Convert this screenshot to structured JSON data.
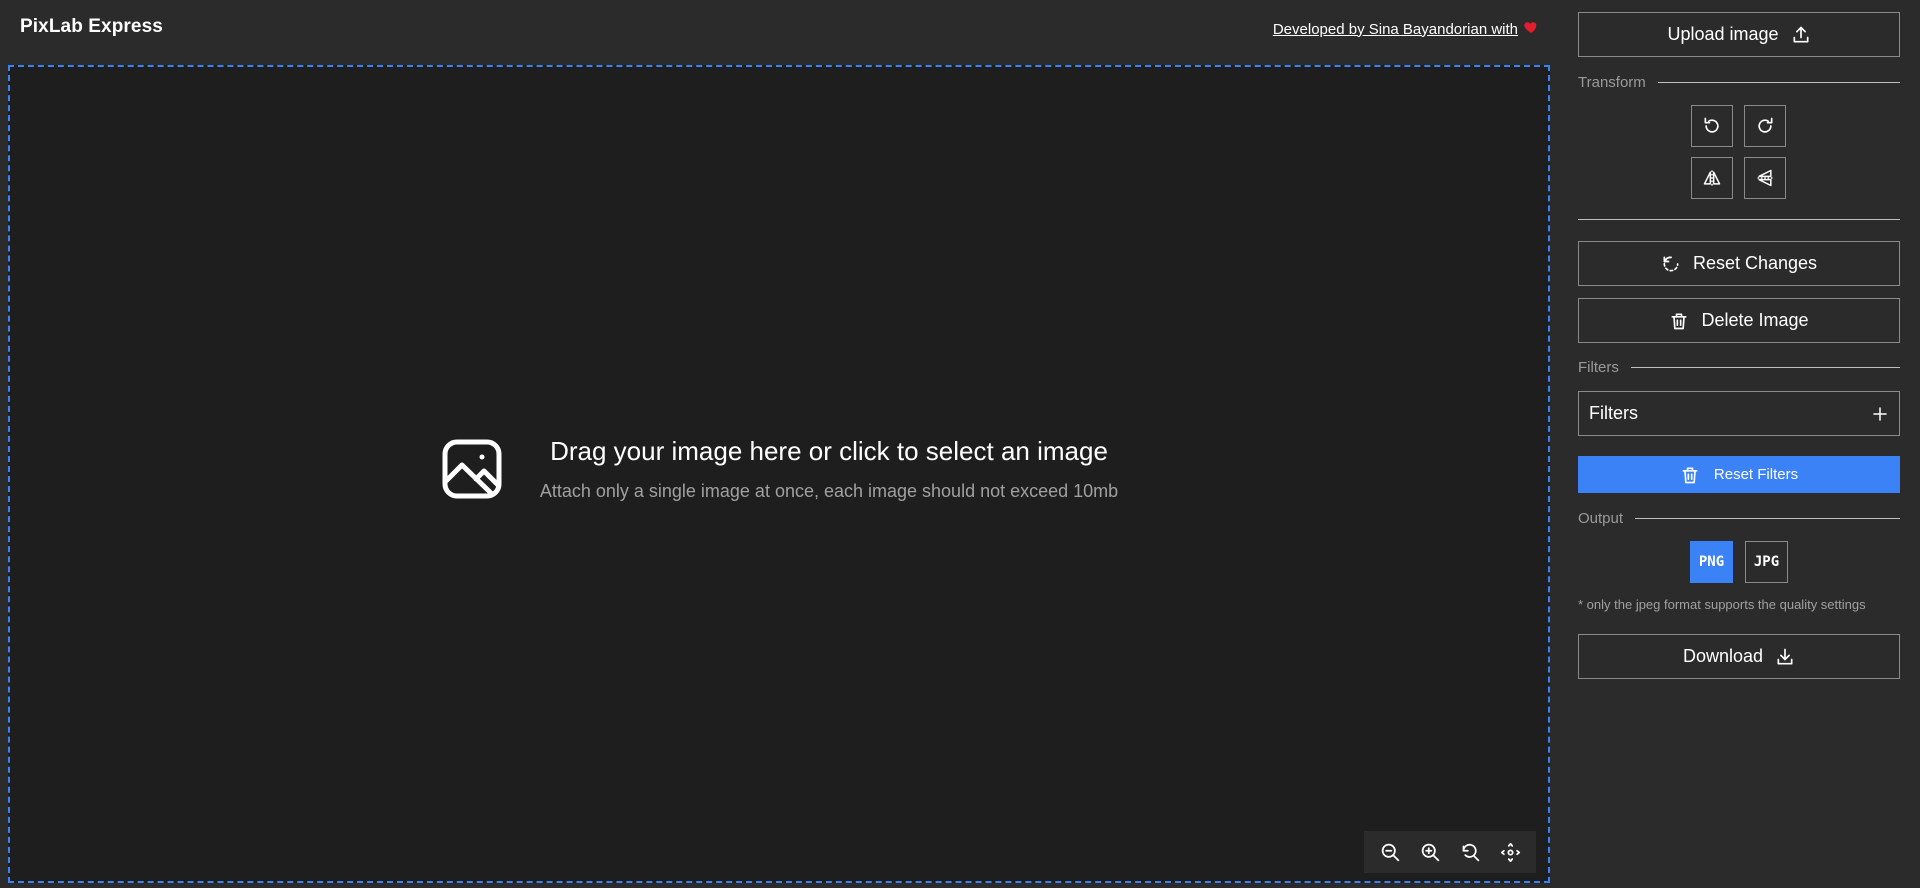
{
  "header": {
    "brand": "PixLab Express",
    "credit": "Developed by Sina Bayandorian with"
  },
  "canvas": {
    "title": "Drag your image here or click to select an image",
    "subtitle": "Attach only a single image at once, each image should not exceed 10mb"
  },
  "sidebar": {
    "upload_label": "Upload image",
    "transform_label": "Transform",
    "reset_changes_label": "Reset Changes",
    "delete_image_label": "Delete Image",
    "filters_section_label": "Filters",
    "filters_select_value": "Filters",
    "reset_filters_label": "Reset Filters",
    "output_label": "Output",
    "formats": [
      "PNG",
      "JPG"
    ],
    "selected_format": "PNG",
    "note": "* only the jpeg format supports the quality settings",
    "download_label": "Download"
  },
  "colors": {
    "accent": "#3b82f6",
    "background": "#2b2b2b",
    "canvas": "#1e1e1e",
    "heart": "#e11d2e"
  }
}
